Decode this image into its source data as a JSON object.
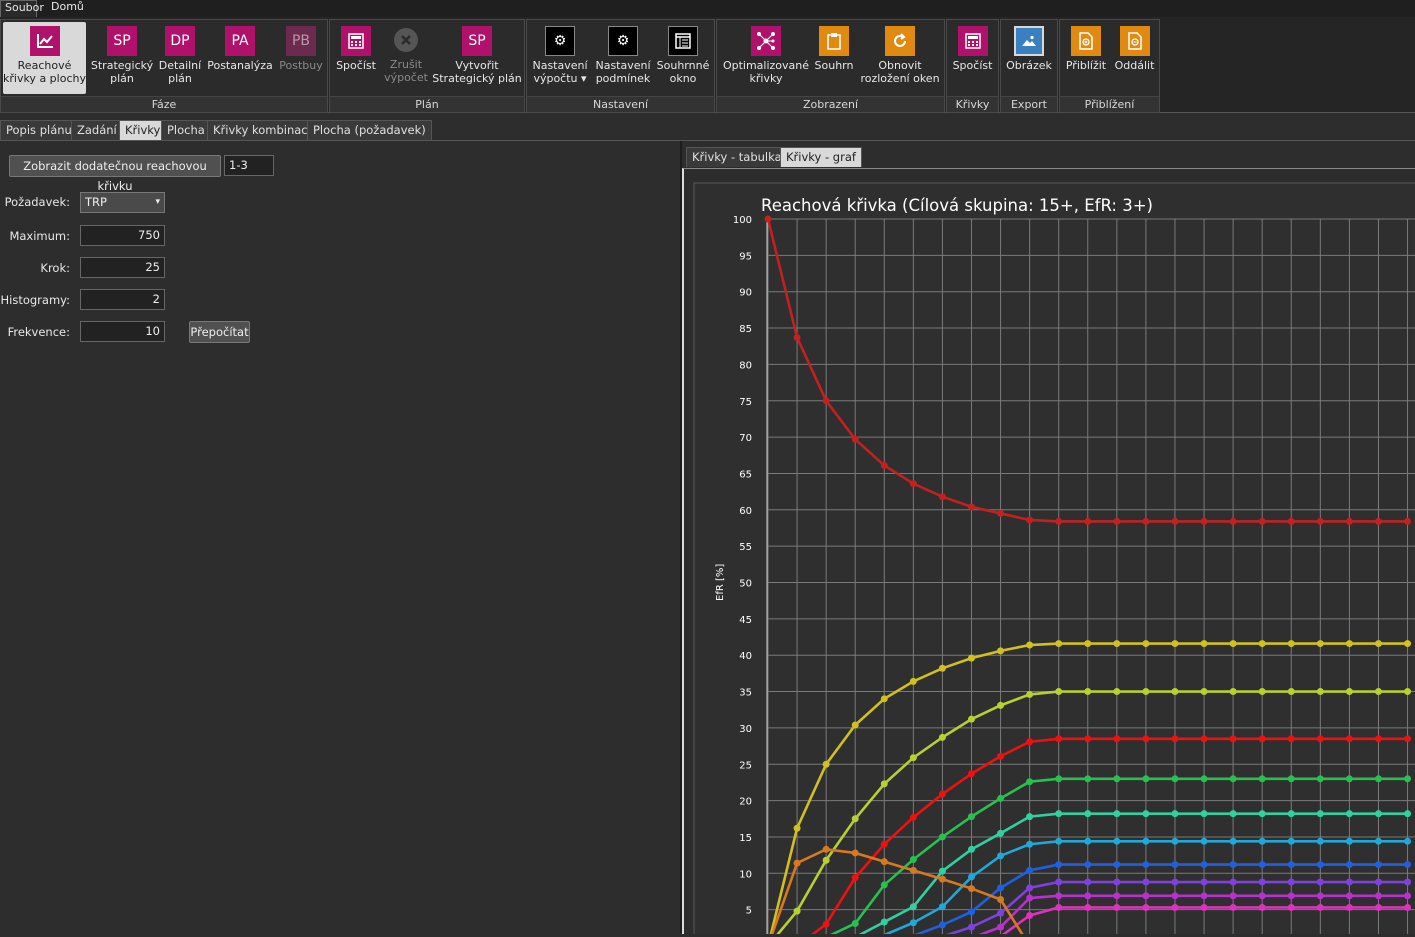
{
  "menu": {
    "soubor": "Soubor",
    "domu": "Domů"
  },
  "ribbon": {
    "faze": {
      "label": "Fáze",
      "reachove": {
        "l1": "Reachové",
        "l2": "křivky a plochy"
      },
      "sp": {
        "icon": "SP",
        "l1": "Strategický",
        "l2": "plán"
      },
      "dp": {
        "icon": "DP",
        "l1": "Detailní",
        "l2": "plán"
      },
      "pa": {
        "icon": "PA",
        "l1": "Postanalýza"
      },
      "pb": {
        "icon": "PB",
        "l1": "Postbuy"
      }
    },
    "plan": {
      "label": "Plán",
      "spocist": {
        "l1": "Spočíst"
      },
      "zrusit": {
        "l1": "Zrušit",
        "l2": "výpočet"
      },
      "vytvorit": {
        "icon": "SP",
        "l1": "Vytvořit",
        "l2": "Strategický plán"
      }
    },
    "nastaveni": {
      "label": "Nastavení",
      "vypoctu": {
        "l1": "Nastavení",
        "l2": "výpočtu ▾"
      },
      "podminek": {
        "l1": "Nastavení",
        "l2": "podmínek"
      },
      "souhrnne": {
        "l1": "Souhrnné",
        "l2": "okno"
      }
    },
    "zobrazeni": {
      "label": "Zobrazení",
      "optim": {
        "l1": "Optimalizované",
        "l2": "křivky"
      },
      "souhrn": {
        "l1": "Souhrn"
      },
      "obnovit": {
        "l1": "Obnovit",
        "l2": "rozložení oken"
      }
    },
    "krivky": {
      "label": "Křivky",
      "spocist": {
        "l1": "Spočíst"
      }
    },
    "export": {
      "label": "Export",
      "obrazek": {
        "l1": "Obrázek"
      }
    },
    "priblizeni": {
      "label": "Přiblížení",
      "priblizit": {
        "l1": "Přiblížit"
      },
      "oddalit": {
        "l1": "Oddálit"
      }
    }
  },
  "tabs": [
    "Popis plánu",
    "Zadání",
    "Křivky",
    "Plocha",
    "Křivky kombinací",
    "Plocha (požadavek)"
  ],
  "left": {
    "show_btn": "Zobrazit dodatečnou reachovou křivku",
    "range_value": "1-3",
    "pozadavek_label": "Požadavek:",
    "pozadavek_value": "TRP",
    "maximum_label": "Maximum:",
    "maximum_value": "750",
    "krok_label": "Krok:",
    "krok_value": "25",
    "histogramy_label": "Histogramy:",
    "histogramy_value": "2",
    "frekvence_label": "Frekvence:",
    "frekvence_value": "10",
    "prepocitat": "Přepočítat"
  },
  "right_tabs": [
    "Křivky - tabulka",
    "Křivky - graf"
  ],
  "chart_data": {
    "type": "line",
    "title": "Reachová křivka (Cílová skupina: 15+, EfR: 3+)",
    "ylabel": "EfR [%]",
    "ylim": [
      0,
      100
    ],
    "yticks": [
      5,
      10,
      15,
      20,
      25,
      30,
      35,
      40,
      45,
      50,
      55,
      60,
      65,
      70,
      75,
      80,
      85,
      90,
      95,
      100
    ],
    "x_step_count": 23,
    "series": [
      {
        "color": "#c42020",
        "values": [
          100,
          83.7,
          75,
          69.7,
          66.1,
          63.6,
          61.8,
          60.4,
          59.5,
          58.6,
          58.4,
          58.4,
          58.4,
          58.4,
          58.4,
          58.4,
          58.4,
          58.4,
          58.4,
          58.4,
          58.4,
          58.4,
          58.4
        ]
      },
      {
        "color": "#d0c020",
        "values": [
          0,
          16.2,
          25,
          30.4,
          34,
          36.4,
          38.2,
          39.6,
          40.6,
          41.4,
          41.6,
          41.6,
          41.6,
          41.6,
          41.6,
          41.6,
          41.6,
          41.6,
          41.6,
          41.6,
          41.6,
          41.6,
          41.6
        ]
      },
      {
        "color": "#b8d030",
        "values": [
          0,
          4.8,
          11.8,
          17.5,
          22.3,
          25.9,
          28.7,
          31.2,
          33.1,
          34.6,
          35,
          35,
          35,
          35,
          35,
          35,
          35,
          35,
          35,
          35,
          35,
          35,
          35
        ]
      },
      {
        "color": "#ee1111",
        "values": [
          0,
          0,
          3,
          9.4,
          14,
          17.7,
          20.9,
          23.7,
          26.1,
          28.1,
          28.5,
          28.5,
          28.5,
          28.5,
          28.5,
          28.5,
          28.5,
          28.5,
          28.5,
          28.5,
          28.5,
          28.5,
          28.5
        ]
      },
      {
        "color": "#28c050",
        "values": [
          0,
          0,
          1.2,
          3.1,
          8.4,
          11.9,
          15,
          17.8,
          20.3,
          22.6,
          23,
          23,
          23,
          23,
          23,
          23,
          23,
          23,
          23,
          23,
          23,
          23,
          23
        ]
      },
      {
        "color": "#30d0a0",
        "values": [
          0,
          0,
          0,
          1.2,
          3.3,
          5.4,
          10.3,
          13.3,
          15.5,
          17.8,
          18.2,
          18.2,
          18.2,
          18.2,
          18.2,
          18.2,
          18.2,
          18.2,
          18.2,
          18.2,
          18.2,
          18.2,
          18.2
        ]
      },
      {
        "color": "#20a8d8",
        "values": [
          0,
          0,
          0,
          0,
          1.5,
          3.2,
          5.4,
          9.5,
          12.4,
          14,
          14.4,
          14.4,
          14.4,
          14.4,
          14.4,
          14.4,
          14.4,
          14.4,
          14.4,
          14.4,
          14.4,
          14.4,
          14.4
        ]
      },
      {
        "color": "#2060e0",
        "values": [
          0,
          0,
          0,
          0,
          0,
          1.4,
          2.9,
          4.7,
          8,
          10.4,
          11.2,
          11.2,
          11.2,
          11.2,
          11.2,
          11.2,
          11.2,
          11.2,
          11.2,
          11.2,
          11.2,
          11.2,
          11.2
        ]
      },
      {
        "color": "#8040e0",
        "values": [
          0,
          0,
          0,
          0,
          0,
          0,
          1.3,
          2.6,
          4.5,
          8,
          8.8,
          8.8,
          8.8,
          8.8,
          8.8,
          8.8,
          8.8,
          8.8,
          8.8,
          8.8,
          8.8,
          8.8,
          8.8
        ]
      },
      {
        "color": "#b830d0",
        "values": [
          0,
          0,
          0,
          0,
          0,
          0,
          0,
          1.1,
          2.6,
          6.6,
          6.9,
          6.9,
          6.9,
          6.9,
          6.9,
          6.9,
          6.9,
          6.9,
          6.9,
          6.9,
          6.9,
          6.9,
          6.9
        ]
      },
      {
        "color": "#e030c0",
        "values": [
          0,
          0,
          0,
          0,
          0,
          0,
          0,
          0,
          1.3,
          4.2,
          5.3,
          5.3,
          5.3,
          5.3,
          5.3,
          5.3,
          5.3,
          5.3,
          5.3,
          5.3,
          5.3,
          5.3,
          5.3
        ]
      },
      {
        "color": "#d87820",
        "values": [
          0,
          11.4,
          13.3,
          12.8,
          11.6,
          10.4,
          9.2,
          7.9,
          6.4,
          0,
          0,
          0,
          0,
          0,
          0,
          0,
          0,
          0,
          0,
          0,
          0,
          0,
          0
        ]
      }
    ]
  }
}
